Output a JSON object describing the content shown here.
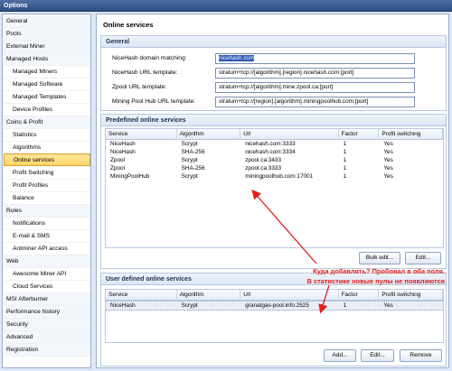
{
  "window": {
    "title": "Options"
  },
  "sidebar": {
    "items": [
      {
        "label": "General"
      },
      {
        "label": "Pools"
      },
      {
        "label": "External Miner"
      },
      {
        "label": "Managed Hosts"
      },
      {
        "label": "Managed Miners"
      },
      {
        "label": "Managed Software"
      },
      {
        "label": "Managed Templates"
      },
      {
        "label": "Device Profiles"
      },
      {
        "label": "Coins & Profit"
      },
      {
        "label": "Statistics"
      },
      {
        "label": "Algorithms"
      },
      {
        "label": "Online services"
      },
      {
        "label": "Profit Switching"
      },
      {
        "label": "Profit Profiles"
      },
      {
        "label": "Balance"
      },
      {
        "label": "Rules"
      },
      {
        "label": "Notifications"
      },
      {
        "label": "E-mail & SMS"
      },
      {
        "label": "Antminer API access"
      },
      {
        "label": "Web"
      },
      {
        "label": "Awesome Miner API"
      },
      {
        "label": "Cloud Services"
      },
      {
        "label": "MSI Afterburner"
      },
      {
        "label": "Performance history"
      },
      {
        "label": "Security"
      },
      {
        "label": "Advanced"
      },
      {
        "label": "Registration"
      }
    ]
  },
  "main": {
    "title": "Online services",
    "general": {
      "heading": "General",
      "fields": [
        {
          "label": "NiceHash domain matching:",
          "value": "nicehash.com"
        },
        {
          "label": "NiceHash URL template:",
          "value": "stratum+tcp://[algorithm].[region].nicehash.com:[port]"
        },
        {
          "label": "Zpool URL template:",
          "value": "stratum+tcp://[algorithm].mine.zpool.ca:[port]"
        },
        {
          "label": "Mining Pool Hub URL template:",
          "value": "stratum+tcp://[region].[algorithm].miningpoolhub.com:[port]"
        }
      ]
    },
    "predefined": {
      "heading": "Predefined online services",
      "columns": [
        "Service",
        "Algorithm",
        "Url",
        "Factor",
        "Profit switching"
      ],
      "rows": [
        [
          "NiceHash",
          "Scrypt",
          "nicehash.com:3333",
          "1",
          "Yes"
        ],
        [
          "NiceHash",
          "SHA-256",
          "nicehash.com:3334",
          "1",
          "Yes"
        ],
        [
          "Zpool",
          "Scrypt",
          "zpool.ca:3433",
          "1",
          "Yes"
        ],
        [
          "Zpool",
          "SHA-256",
          "zpool.ca:3333",
          "1",
          "Yes"
        ],
        [
          "MiningPoolHub",
          "Scrypt",
          "miningpoolhub.com:17001",
          "1",
          "Yes"
        ]
      ],
      "buttons": {
        "bulk_edit": "Bulk edit...",
        "edit": "Edit..."
      }
    },
    "user_defined": {
      "heading": "User defined online services",
      "columns": [
        "Service",
        "Algorithm",
        "Url",
        "Factor",
        "Profit switching"
      ],
      "rows": [
        [
          "NiceHash",
          "Scrypt",
          "granatgas-pool.info:2525",
          "1",
          "Yes"
        ]
      ],
      "buttons": {
        "add": "Add...",
        "edit": "Edit...",
        "remove": "Remove"
      }
    },
    "annotation": {
      "line1": "Куда добавлять? Пробовал в оба поля.",
      "line2": "В статистике новые пулы не появляются",
      "color": "#e0201b"
    }
  }
}
